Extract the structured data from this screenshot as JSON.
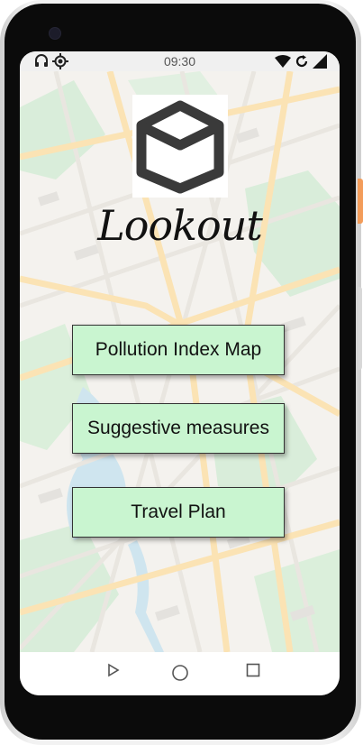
{
  "status": {
    "time": "09:30",
    "left_icons": [
      "headphones-icon",
      "location-icon"
    ],
    "right_icons": [
      "wifi-icon",
      "sync-icon",
      "signal-icon"
    ]
  },
  "app": {
    "title": "Lookout",
    "logo_icon": "cube-icon"
  },
  "menu": {
    "pollution_label": "Pollution Index Map",
    "suggestive_label": "Suggestive measures",
    "travel_label": "Travel Plan",
    "button_color": "#c9f5d0"
  },
  "nav": {
    "icons": [
      "back-icon",
      "home-icon",
      "recents-icon"
    ]
  }
}
